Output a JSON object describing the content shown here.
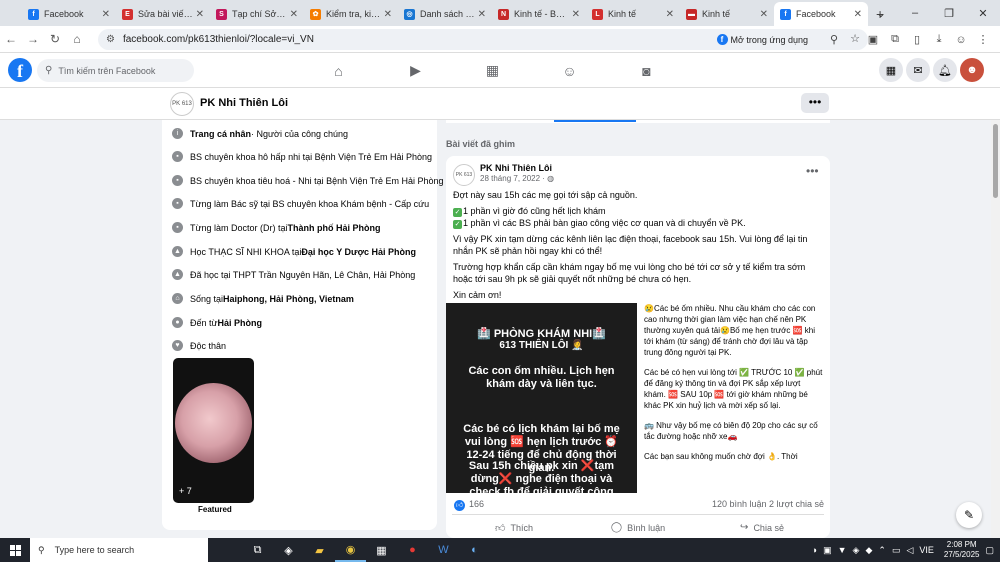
{
  "browser": {
    "tabs": [
      {
        "label": "Facebook",
        "color": "#1877f2",
        "glyph": "f"
      },
      {
        "label": "Sửa bài viết - E",
        "color": "#d32f2f",
        "glyph": "E"
      },
      {
        "label": "Tạp chí Sở hữu",
        "color": "#c2185b",
        "glyph": "S"
      },
      {
        "label": "Kiểm tra, kiểm",
        "color": "#f57c00",
        "glyph": "✿"
      },
      {
        "label": "Danh sách tin",
        "color": "#1976d2",
        "glyph": "◎"
      },
      {
        "label": "Kinh tế - Báo N",
        "color": "#c62828",
        "glyph": "N"
      },
      {
        "label": "Kinh tế",
        "color": "#d32f2f",
        "glyph": "L"
      },
      {
        "label": "Kinh tế",
        "color": "#c62828",
        "glyph": "▬"
      },
      {
        "label": "Facebook",
        "color": "#1877f2",
        "glyph": "f"
      }
    ],
    "url": "facebook.com/pk613thienloi/?locale=vi_VN",
    "open_in_app": "Mở trong ứng dụng"
  },
  "facebook": {
    "search_placeholder": "Tìm kiếm trên Facebook"
  },
  "page": {
    "name": "PK Nhi Thiên Lôi",
    "avatar_text": "PK 613"
  },
  "intro": {
    "items": [
      {
        "icon": "i",
        "parts": [
          {
            "b": "Trang cá nhân"
          },
          {
            "t": " · Người của công chúng"
          }
        ]
      },
      {
        "icon": "▪",
        "parts": [
          {
            "t": "BS chuyên khoa hô hấp nhi tại Bệnh Viện Trẻ Em Hải Phòng"
          }
        ]
      },
      {
        "icon": "▪",
        "parts": [
          {
            "t": "BS chuyên khoa tiêu hoá - Nhi tại Bệnh Viện Trẻ Em Hải Phòng"
          }
        ]
      },
      {
        "icon": "▪",
        "parts": [
          {
            "t": "Từng làm Bác sỹ tại BS chuyên khoa Khám bệnh - Cấp cứu"
          }
        ]
      },
      {
        "icon": "▪",
        "parts": [
          {
            "t": "Từng làm Doctor (Dr) tại "
          },
          {
            "b": "Thành phố Hải Phòng"
          }
        ]
      },
      {
        "icon": "▲",
        "parts": [
          {
            "t": "Học THẠC SĨ NHI KHOA tại "
          },
          {
            "b": "Đại học Y Dược Hải Phòng"
          }
        ]
      },
      {
        "icon": "▲",
        "parts": [
          {
            "t": "Đã học tại THPT Trần Nguyên Hãn, Lê Chân, Hải Phòng"
          }
        ]
      },
      {
        "icon": "⌂",
        "parts": [
          {
            "t": "Sống tại "
          },
          {
            "b": "Haiphong, Hải Phòng, Vietnam"
          }
        ]
      },
      {
        "icon": "●",
        "parts": [
          {
            "t": "Đến từ "
          },
          {
            "b": "Hải Phòng"
          }
        ]
      },
      {
        "icon": "♥",
        "parts": [
          {
            "t": "Độc thân"
          }
        ]
      }
    ],
    "photo_count": "+ 7",
    "featured": "Featured"
  },
  "pinned_label": "Bài viết đã ghim",
  "post": {
    "author": "PK Nhi Thiên Lôi",
    "date": "28 tháng 7, 2022 · ",
    "line1": "Đợt này sau 15h các mẹ gọi tới sập cả nguồn.",
    "line2": "1 phần vì giờ đó cũng hết lịch khám",
    "line3": "1 phần vì các BS phải bàn giao công việc cơ quan và di chuyển về PK.",
    "line4": "Vì vậy PK xin tạm dừng các kênh liên lạc điện thoại, facebook sau 15h. Vui lòng để lại tin nhắn PK sẽ phản hồi ngay khi có thể!",
    "line5": "Trường hợp khẩn cấp cần khám ngay bố mẹ vui lòng cho bé tới cơ sở y tế kiểm tra sớm hoặc tới sau 9h pk sẽ giải quyết nốt những bé chưa có hẹn.",
    "line6": "Xin cảm ơn!",
    "img_title": "🏥 PHÒNG KHÁM NHI🏥",
    "img_sub": "613 THIÊN LÔI 👩‍⚕️",
    "img_p1": "Các con ốm nhiều. Lịch hẹn khám dày và liên tục.",
    "img_p2": "Các bé có lịch khám lại bố mẹ vui lòng 🆘 hẹn lịch trước ⏰ 12-24 tiếng để chủ động thời gian.",
    "img_p3": "Sau 15h chiều pk xin ❌tạm dừng❌ nghe điện thoại và check fb để giải quyết công",
    "side_p1": "😢Các bé ốm nhiều. Nhu cầu khám cho các con cao nhưng thời gian làm việc hạn chế nên PK thường xuyên quá tải😢Bố mẹ hẹn trước 🆘 khi tới khám (từ sáng) để tránh chờ đợi lâu và tập trung đông người tại PK.",
    "side_p2": "Các bé có hẹn vui lòng tới ✅ TRƯỚC 10 ✅ phút để đăng ký thông tin và đợi PK sắp xếp lượt khám. 🆘 SAU 10p 🆘 tới giờ khám những bé khác PK xin huỷ lịch và mời xếp số lại.",
    "side_p3": "🚌 Như vậy bố mẹ có biên độ 20p cho các sự cố tắc đường hoặc nhỡ xe🚗",
    "side_p4": "Các bạn sau không muốn chờ đợi 👌. Thời",
    "likes": "166",
    "comments_shares": "120 bình luận   2 lượt chia sẻ",
    "like": "Thích",
    "comment": "Bình luận",
    "share": "Chia sẻ"
  },
  "taskbar": {
    "search_placeholder": "Type here to search",
    "lang": "VIE",
    "time": "2:08 PM",
    "date": "27/5/2025"
  }
}
